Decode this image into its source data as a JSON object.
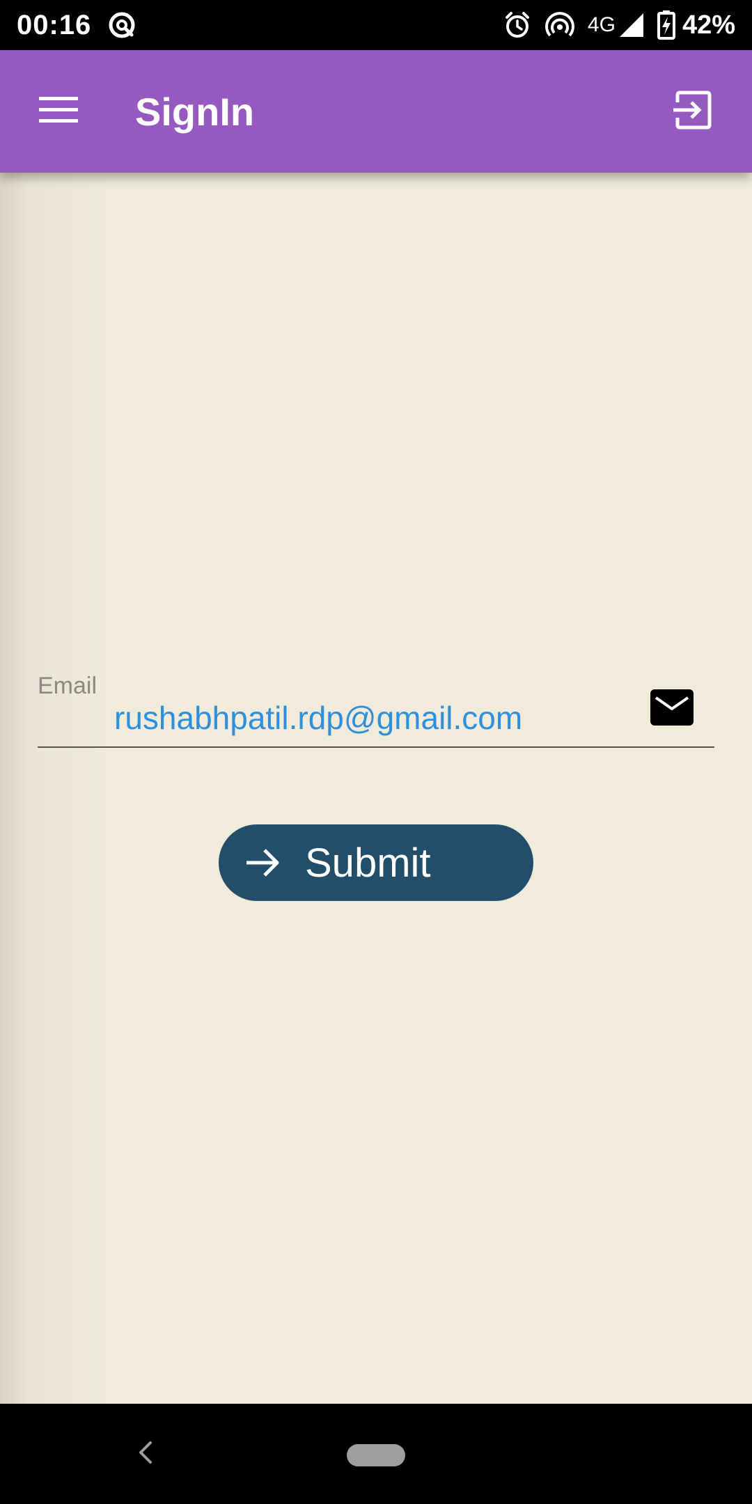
{
  "status_bar": {
    "time": "00:16",
    "network_type": "4G",
    "battery_percent": "42%",
    "icons": [
      "data-saver-icon",
      "alarm-icon",
      "hotspot-icon",
      "signal-icon",
      "battery-charging-icon"
    ]
  },
  "app_bar": {
    "title": "SignIn",
    "background_color": "#9659bf",
    "menu_icon": "hamburger-menu-icon",
    "action_icon": "exit-to-app-icon"
  },
  "form": {
    "email_label": "Email",
    "email_value": "rushabhpatil.rdp@gmail.com",
    "email_icon": "mail-icon",
    "submit_label": "Submit",
    "submit_icon": "arrow-right-icon",
    "submit_color": "#224e69"
  },
  "nav_bar": {
    "back_icon": "back-chevron-icon",
    "home_icon": "home-pill-icon"
  }
}
